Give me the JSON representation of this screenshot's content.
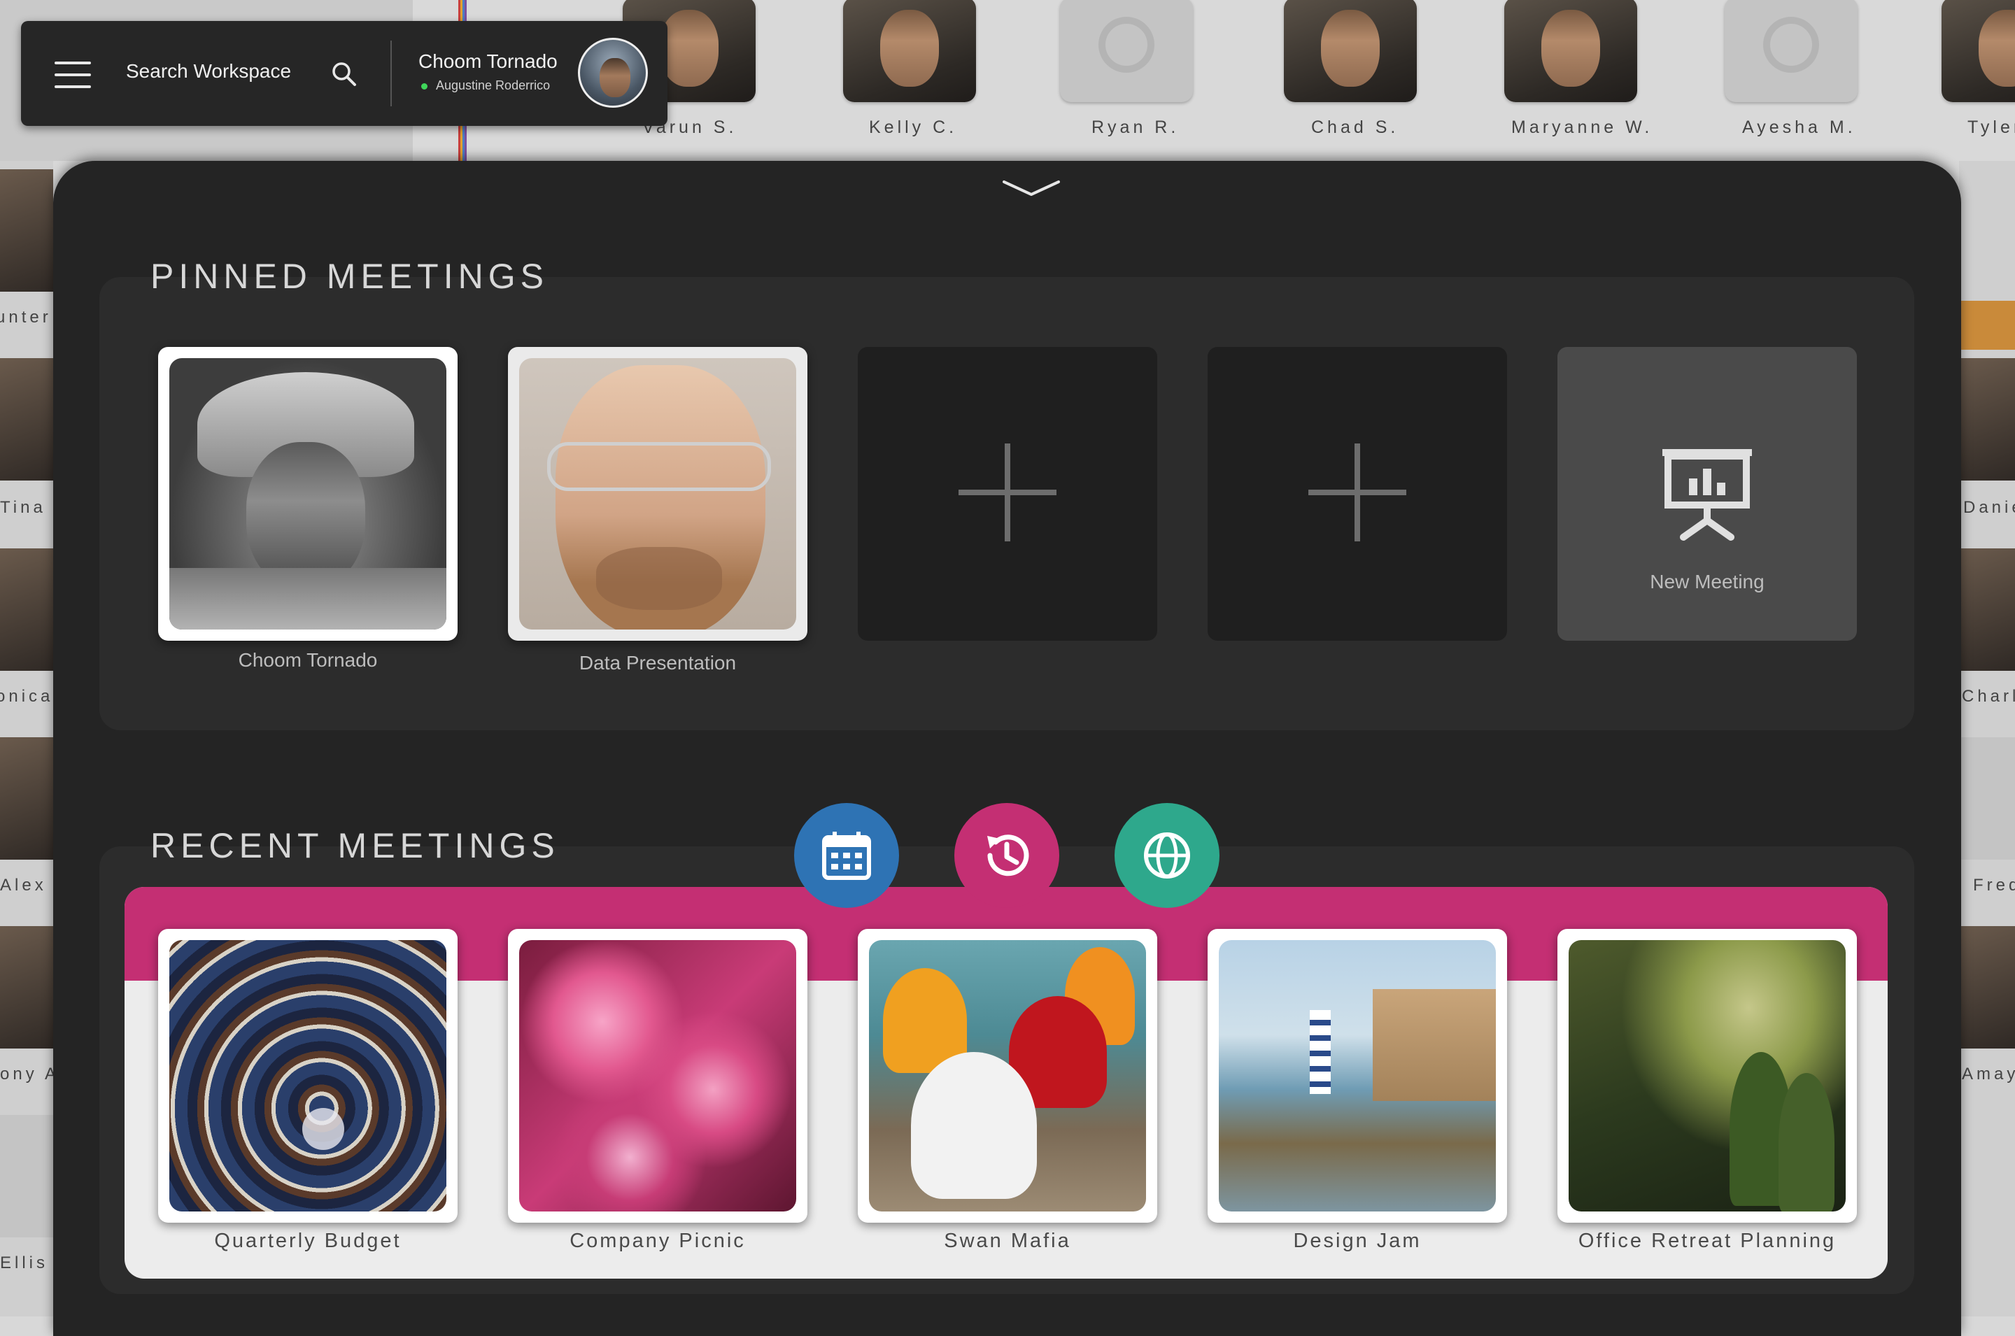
{
  "background_people": {
    "top_row": [
      {
        "name": "Varun S.",
        "type": "photo"
      },
      {
        "name": "Kelly C.",
        "type": "photo"
      },
      {
        "name": "Ryan R.",
        "type": "placeholder"
      },
      {
        "name": "Chad S.",
        "type": "photo"
      },
      {
        "name": "Maryanne W.",
        "type": "photo"
      },
      {
        "name": "Ayesha M.",
        "type": "placeholder"
      },
      {
        "name": "Tyler",
        "type": "photo"
      }
    ],
    "left_column": [
      "unter",
      "Tina R",
      "onica",
      "Alex V",
      "ony A",
      "Ellis G"
    ],
    "right_column": [
      "Danie",
      "Charle",
      "Fred",
      "Amay"
    ]
  },
  "topbar": {
    "search_label": "Search Workspace",
    "user_name": "Choom Tornado",
    "user_status": "Augustine Roderrico",
    "status_color": "#3fd75a"
  },
  "pinned": {
    "title": "PINNED MEETINGS",
    "tiles": [
      {
        "label": "Choom Tornado",
        "type": "photo"
      },
      {
        "label": "Data Presentation",
        "type": "photo"
      },
      {
        "label": "",
        "type": "add"
      },
      {
        "label": "",
        "type": "add"
      },
      {
        "label": "New Meeting",
        "type": "new"
      }
    ]
  },
  "recent": {
    "title": "RECENT MEETINGS",
    "band_color": "#c42f73",
    "filters": [
      {
        "icon": "calendar-icon",
        "color": "#2e73b4"
      },
      {
        "icon": "history-icon",
        "color": "#c42f73"
      },
      {
        "icon": "globe-icon",
        "color": "#2ea88c"
      }
    ],
    "tiles": [
      {
        "label": "Quarterly Budget"
      },
      {
        "label": "Company Picnic"
      },
      {
        "label": "Swan Mafia"
      },
      {
        "label": "Design Jam"
      },
      {
        "label": "Office Retreat Planning"
      }
    ]
  }
}
